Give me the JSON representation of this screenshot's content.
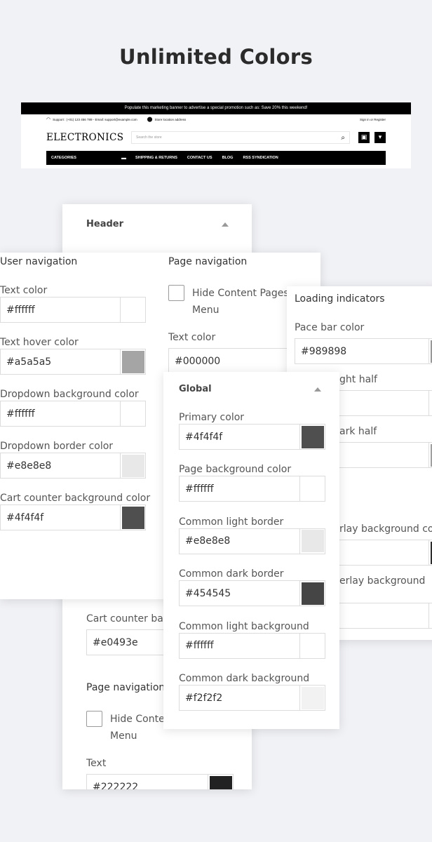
{
  "page_title": "Unlimited Colors",
  "store": {
    "promo": "Populate this marketing banner to advertise a special promotion such as: Save 20% this weekend!",
    "support": "Support : (+01) 123 456 789 - Email: support@example.com",
    "location": "Store location address",
    "sign_in": "Sign in or Register",
    "brand": "ELECTRONICS",
    "search_placeholder": "Search the store",
    "nav": {
      "categories": "CATEGORIES",
      "shipping": "SHIPPING & RETURNS",
      "contact": "CONTACT US",
      "blog": "BLOG",
      "rss": "RSS SYNDICATION"
    }
  },
  "header_card": {
    "title": "Header",
    "cart_counter_label": "Cart counter back",
    "cart_counter_value": "#e0493e",
    "page_nav_title": "Page navigation",
    "hide_content_line1": "Hide Conten",
    "hide_content_line2": "Menu",
    "text_label": "Text",
    "text_value": "#222222",
    "text_swatch": "#222222"
  },
  "user_nav_card": {
    "title": "User navigation",
    "fields": [
      {
        "label": "Text color",
        "value": "#ffffff",
        "swatch": "#ffffff"
      },
      {
        "label": "Text hover color",
        "value": "#a5a5a5",
        "swatch": "#a5a5a5"
      },
      {
        "label": "Dropdown background color",
        "value": "#ffffff",
        "swatch": "#ffffff"
      },
      {
        "label": "Dropdown border color",
        "value": "#e8e8e8",
        "swatch": "#e8e8e8"
      },
      {
        "label": "Cart counter background color",
        "value": "#4f4f4f",
        "swatch": "#4f4f4f"
      }
    ],
    "page_nav_title": "Page navigation",
    "hide_content_line1": "Hide Content Pages in",
    "hide_content_line2": "Menu",
    "text_color_label": "Text color",
    "text_color_value": "#000000"
  },
  "loading_card": {
    "title": "Loading indicators",
    "pace_label": "Pace bar color",
    "pace_value": "#989898",
    "pace_swatch": "#989898",
    "light_half_label": "ght half",
    "dark_half_label": "ark half",
    "dark_half_swatch": "#a0a0a0",
    "overlay_bg_label": "rlay background colo",
    "overlay_bg_swatch": "#2d2d2d",
    "overlay_bg2_label": "erlay background"
  },
  "global_card": {
    "title": "Global",
    "fields": [
      {
        "label": "Primary color",
        "value": "#4f4f4f",
        "swatch": "#4f4f4f"
      },
      {
        "label": "Page background color",
        "value": "#ffffff",
        "swatch": "#ffffff"
      },
      {
        "label": "Common light border",
        "value": "#e8e8e8",
        "swatch": "#e8e8e8"
      },
      {
        "label": "Common dark border",
        "value": "#454545",
        "swatch": "#454545"
      },
      {
        "label": "Common light background",
        "value": "#ffffff",
        "swatch": "#ffffff"
      },
      {
        "label": "Common dark background",
        "value": "#f2f2f2",
        "swatch": "#f2f2f2"
      }
    ]
  },
  "icons": {
    "headset": "headset-icon",
    "pin": "location-pin-icon",
    "search": "search-icon",
    "gift": "gift-icon",
    "cart": "cart-icon",
    "menu": "menu-icon",
    "collapse": "chevron-up-icon"
  }
}
